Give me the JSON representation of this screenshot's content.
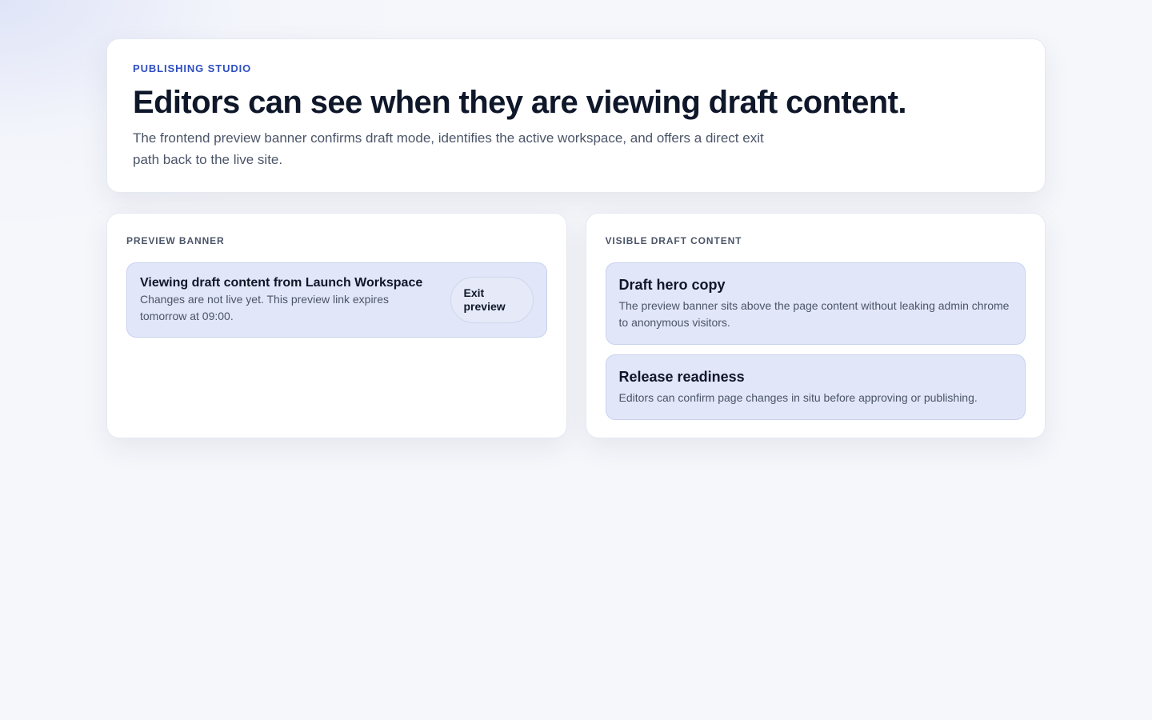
{
  "hero": {
    "eyebrow": "PUBLISHING STUDIO",
    "title": "Editors can see when they are viewing draft content.",
    "description": "The frontend preview banner confirms draft mode, identifies the active workspace, and offers a direct exit path back to the live site."
  },
  "preview_banner_panel": {
    "label": "PREVIEW BANNER",
    "banner": {
      "title": "Viewing draft content from Launch Workspace",
      "subtitle": "Changes are not live yet. This preview link expires tomorrow at 09:00.",
      "exit_label": "Exit preview"
    }
  },
  "draft_content_panel": {
    "label": "VISIBLE DRAFT CONTENT",
    "cards": [
      {
        "title": "Draft hero copy",
        "description": "The preview banner sits above the page content without leaking admin chrome to anonymous visitors."
      },
      {
        "title": "Release readiness",
        "description": "Editors can confirm page changes in situ before approving or publishing."
      }
    ]
  },
  "colors": {
    "accent": "#2f4fbf",
    "card_bg": "#e1e6f8",
    "text_primary": "#0f172a",
    "text_secondary": "#4b5568"
  }
}
